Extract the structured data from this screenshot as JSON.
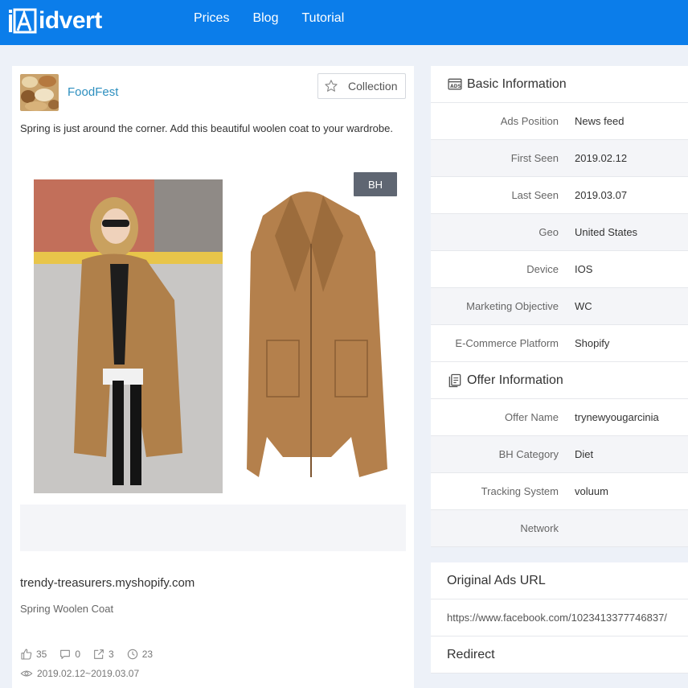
{
  "brand": {
    "name": "idvert",
    "logo_icon": "idvert-logo-icon"
  },
  "nav": [
    {
      "label": "Prices"
    },
    {
      "label": "Blog"
    },
    {
      "label": "Tutorial"
    }
  ],
  "ad": {
    "advertiser": "FoodFest",
    "collection_label": "Collection",
    "text": "Spring is just around the corner. Add this beautiful woolen coat to your wardrobe.",
    "badge": "BH",
    "domain": "trendy-treasurers.myshopify.com",
    "product": "Spring Woolen Coat",
    "stats": {
      "likes": "35",
      "comments": "0",
      "shares": "3",
      "days": "23"
    },
    "date_range": "2019.02.12~2019.03.07"
  },
  "basic": {
    "title": "Basic Information",
    "rows": [
      {
        "label": "Ads Position",
        "value": "News feed"
      },
      {
        "label": "First Seen",
        "value": "2019.02.12"
      },
      {
        "label": "Last Seen",
        "value": "2019.03.07"
      },
      {
        "label": "Geo",
        "value": "United States"
      },
      {
        "label": "Device",
        "value": "IOS"
      },
      {
        "label": "Marketing Objective",
        "value": "WC"
      },
      {
        "label": "E-Commerce Platform",
        "value": "Shopify"
      }
    ]
  },
  "offer": {
    "title": "Offer Information",
    "rows": [
      {
        "label": "Offer Name",
        "value": "trynewyougarcinia"
      },
      {
        "label": "BH Category",
        "value": "Diet"
      },
      {
        "label": "Tracking System",
        "value": "voluum"
      },
      {
        "label": "Network",
        "value": ""
      }
    ]
  },
  "original_url": {
    "title": "Original Ads URL",
    "value": "https://www.facebook.com/1023413377746837/"
  },
  "redirect": {
    "title": "Redirect"
  },
  "colors": {
    "header": "#0b7dea",
    "advertiser": "#2d8fbf",
    "badge": "#5f6672"
  }
}
